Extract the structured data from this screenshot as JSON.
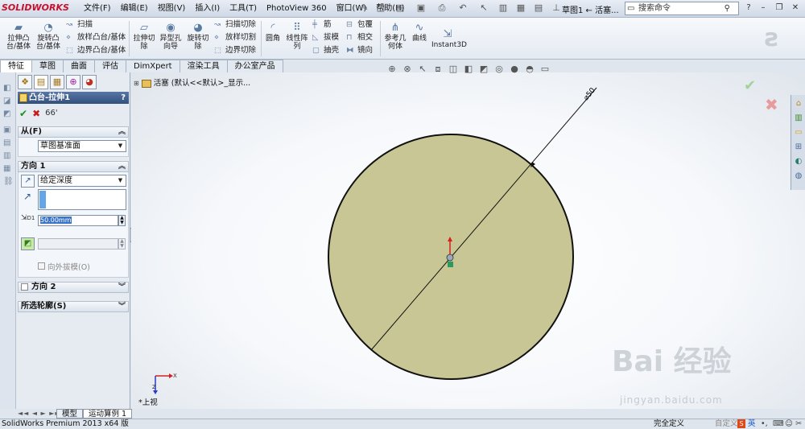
{
  "app": {
    "logo": "SOLIDWORKS",
    "doc_title": "草图1 ← 活塞...",
    "status": "SolidWorks Premium 2013 x64 版",
    "status_right": "完全定义",
    "status_right2": "自定义",
    "ime": "英"
  },
  "menus": [
    "文件(F)",
    "编辑(E)",
    "视图(V)",
    "插入(I)",
    "工具(T)",
    "PhotoView 360",
    "窗口(W)",
    "帮助(H)"
  ],
  "search": {
    "placeholder": "搜索命令"
  },
  "toolbar": {
    "extrude_boss": "拉伸凸台/基体",
    "revolve_boss": "旋转凸台/基体",
    "sweep": "扫描",
    "loft": "放样凸台/基体",
    "boundary_boss": "边界凸台/基体",
    "extrude_cut": "拉伸切除",
    "hole_wizard": "异型孔向导",
    "revolve_cut": "旋转切除",
    "swept_cut": "扫描切除",
    "lofted_cut": "放样切割",
    "boundary_cut": "边界切除",
    "fillet": "圆角",
    "linear_pattern": "线性阵列",
    "rib": "筋",
    "draft": "拔模",
    "shell": "抽壳",
    "wrap": "包覆",
    "intersect": "相交",
    "mirror": "镜向",
    "ref_geometry": "参考几何体",
    "curves": "曲线",
    "instant3d": "Instant3D"
  },
  "cmd_tabs": [
    "特征",
    "草图",
    "曲面",
    "评估",
    "DimXpert",
    "渲染工具",
    "办公室产品"
  ],
  "tree": {
    "label": "活塞  (默认<<默认>_显示..."
  },
  "pm": {
    "title": "凸台-拉伸1",
    "help": "?",
    "from": {
      "label": "从(F)",
      "value": "草图基准面"
    },
    "dir1": {
      "label": "方向 1",
      "end_condition": "给定深度",
      "depth": "50.00mm",
      "depth_label": "D1",
      "draft_outward": "向外拔模(O)"
    },
    "dir2": {
      "label": "方向 2"
    },
    "contours": {
      "label": "所选轮廓(S)"
    }
  },
  "sketch": {
    "dimension": "⌀50",
    "view_label": "*上视",
    "axis_x": "X",
    "axis_z": "Z"
  },
  "bottom_tabs": [
    "模型",
    "运动算例 1"
  ],
  "watermark": {
    "brand": "Bai 经验",
    "url": "jingyan.baidu.com"
  },
  "colors": {
    "disk_fill": "#c7c694",
    "disk_stroke": "#111111",
    "accent": "#33507d",
    "brand_red": "#c8102e"
  }
}
